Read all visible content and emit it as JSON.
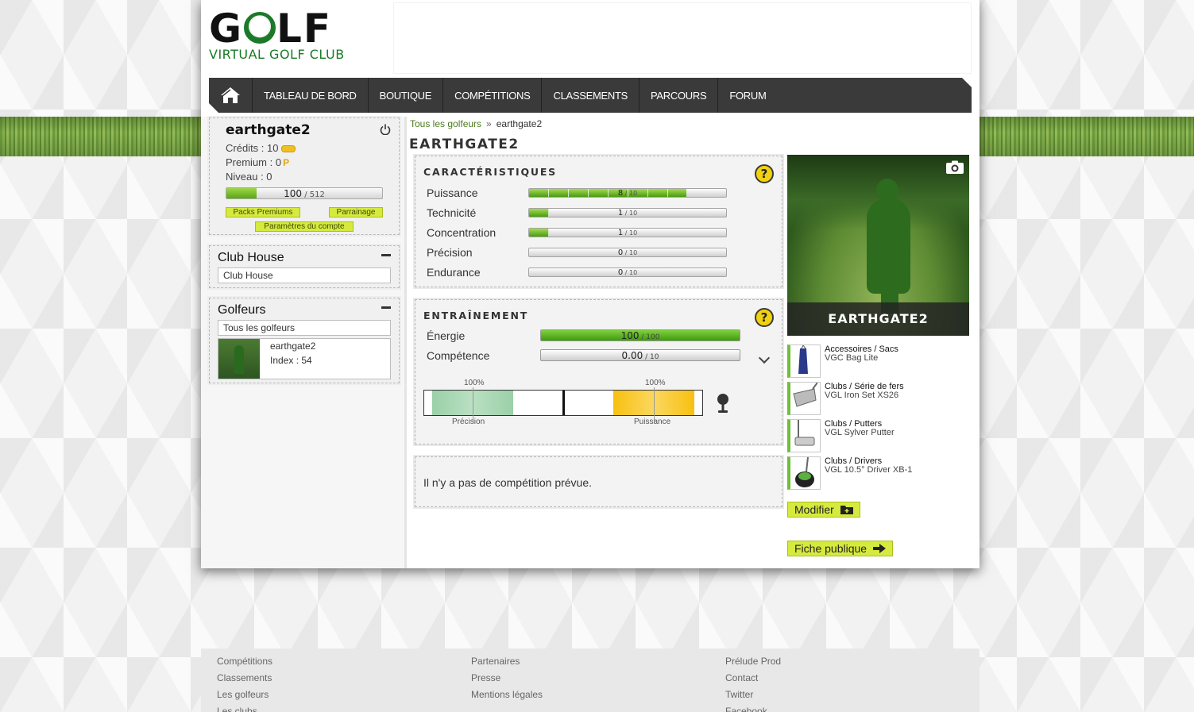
{
  "logo": {
    "word_left": "G",
    "word_right": "LF",
    "subtitle": "VIRTUAL GOLF CLUB"
  },
  "nav": {
    "items": [
      "TABLEAU DE BORD",
      "BOUTIQUE",
      "COMPÉTITIONS",
      "CLASSEMENTS",
      "PARCOURS",
      "FORUM"
    ]
  },
  "user": {
    "name": "earthgate2",
    "credits": "Crédits : 10",
    "premium": "Premium : 0",
    "premium_symbol": "P",
    "level": "Niveau : 0",
    "xp_value": "100",
    "xp_max": " / 512",
    "xp_fraction": 0.195,
    "btn_packs": "Packs Premiums",
    "btn_parrainage": "Parrainage",
    "btn_params": "Paramètres du compte"
  },
  "club_house": {
    "title": "Club House",
    "field": "Club House"
  },
  "golfeurs": {
    "title": "Golfeurs",
    "field": "Tous les golfeurs",
    "card_name": "earthgate2",
    "card_index": "Index : 54"
  },
  "breadcrumb": {
    "link": "Tous les golfeurs",
    "sep": "»",
    "current": "earthgate2"
  },
  "page_title": "EARTHGATE2",
  "caracteristiques": {
    "title": "CARACTÉRISTIQUES",
    "help": "?",
    "stats": [
      {
        "label": "Puissance",
        "value": "8",
        "max": " / 10",
        "fraction": 0.8
      },
      {
        "label": "Technicité",
        "value": "1",
        "max": " / 10",
        "fraction": 0.1
      },
      {
        "label": "Concentration",
        "value": "1",
        "max": " / 10",
        "fraction": 0.1
      },
      {
        "label": "Précision",
        "value": "0",
        "max": " / 10",
        "fraction": 0
      },
      {
        "label": "Endurance",
        "value": "0",
        "max": " / 10",
        "fraction": 0
      }
    ]
  },
  "entrainement": {
    "title": "ENTRAÎNEMENT",
    "help": "?",
    "energie_label": "Énergie",
    "energie_value": "100",
    "energie_max": " / 100",
    "energie_fraction": 1,
    "competence_label": "Compétence",
    "competence_value": "0.00",
    "competence_max": " / 10",
    "competence_fraction": 0,
    "precision_pct": "100%",
    "puissance_pct": "100%",
    "precision_label": "Précision",
    "puissance_label": "Puissance"
  },
  "competition": {
    "message": "Il n'y a pas de compétition prévue."
  },
  "profile": {
    "caption": "EARTHGATE2"
  },
  "equipment": [
    {
      "category": "Accessoires / Sacs",
      "name": "VGC Bag Lite"
    },
    {
      "category": "Clubs / Série de fers",
      "name": "VGL Iron Set XS26"
    },
    {
      "category": "Clubs / Putters",
      "name": "VGL Sylver Putter"
    },
    {
      "category": "Clubs / Drivers",
      "name": "VGL 10.5° Driver XB-1"
    }
  ],
  "buttons": {
    "modifier": "Modifier",
    "fiche": "Fiche publique"
  },
  "footer": {
    "col1": [
      "Compétitions",
      "Classements",
      "Les golfeurs",
      "Les clubs"
    ],
    "col2": [
      "Partenaires",
      "Presse",
      "Mentions légales"
    ],
    "col3": [
      "Prélude Prod",
      "Contact",
      "Twitter",
      "Facebook"
    ]
  },
  "colors": {
    "accent_green": "#5aa516",
    "button_yellow": "#d6ea3e",
    "nav_dark": "#3a3a3a",
    "help_yellow": "#f2d20e"
  }
}
